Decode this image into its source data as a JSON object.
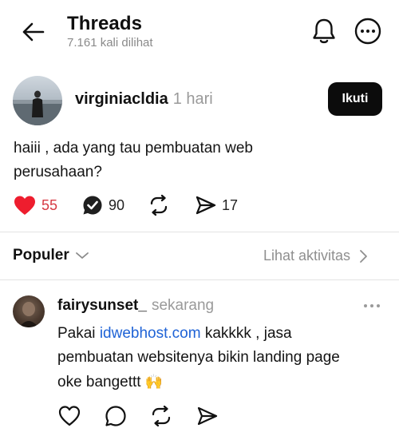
{
  "header": {
    "title": "Threads",
    "views": "7.161 kali dilihat",
    "icons": {
      "back": "arrow-left-icon",
      "notifications": "bell-icon",
      "more": "more-circle-icon"
    }
  },
  "post": {
    "author": "virginiacldia",
    "time": "1 hari",
    "follow_label": "Ikuti",
    "text_line1": "haiii , ada yang tau pembuatan web",
    "text_line2": "perusahaan?",
    "likes": "55",
    "replies": "90",
    "shares": "17",
    "liked": true,
    "like_color": "#ee1d2e"
  },
  "sort": {
    "label": "Populer",
    "activity_label": "Lihat aktivitas"
  },
  "reply": {
    "author": "fairysunset_",
    "time": "sekarang",
    "text_prefix": "Pakai ",
    "link_text": "idwebhost.com",
    "text_suffix": " kakkkk , jasa",
    "text_line2": "pembuatan websitenya bikin landing page",
    "text_line3": "oke bangettt",
    "emoji": "🙌",
    "link_color": "#1f63d6"
  }
}
